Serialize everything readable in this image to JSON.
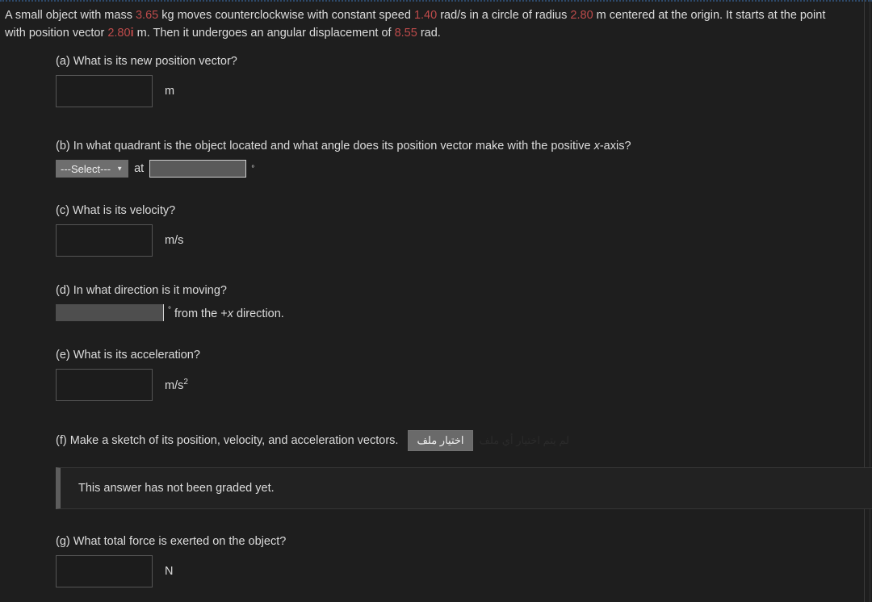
{
  "problem": {
    "text_1": "A small object with mass ",
    "mass": "3.65",
    "text_2": " kg moves counterclockwise with constant speed ",
    "speed": "1.40",
    "text_3": " rad/s in a circle of radius ",
    "radius": "2.80",
    "text_4": " m centered at the origin. It starts at the point with position vector ",
    "position": "2.80",
    "position_unit_vector": "i",
    "text_5": " m. Then it undergoes an angular displacement of ",
    "displacement": "8.55",
    "text_6": " rad."
  },
  "parts": {
    "a": {
      "question": "(a) What is its new position vector?",
      "value": "",
      "unit": "m"
    },
    "b": {
      "question_pre": "(b) In what quadrant is the object located and what angle does its position vector make with the positive ",
      "question_italic": "x",
      "question_post": "-axis?",
      "select_value": "---Select---",
      "caret": "▼",
      "at_label": "at",
      "value": "",
      "unit": "°"
    },
    "c": {
      "question": "(c) What is its velocity?",
      "value": "",
      "unit": "m/s"
    },
    "d": {
      "question": "(d) In what direction is it moving?",
      "value": "",
      "degree": "°",
      "suffix_pre": " from the +",
      "suffix_italic": "x",
      "suffix_post": " direction."
    },
    "e": {
      "question": "(e) What is its acceleration?",
      "value": "",
      "unit_base": "m/s",
      "unit_sup": "2"
    },
    "f": {
      "question": "(f) Make a sketch of its position, velocity, and acceleration vectors.",
      "file_button_label": "اختيار ملف",
      "file_status": "لم يتم اختيار أي ملف",
      "notice": "This answer has not been graded yet."
    },
    "g": {
      "question": "(g) What total force is exerted on the object?",
      "value": "",
      "unit": "N"
    }
  },
  "colors": {
    "background": "#1e1e1e",
    "text": "#dcdcdc",
    "number_highlight": "#bf4b4b",
    "input_border": "#555555",
    "select_background": "#6e6e6e",
    "notice_accent": "#5d5d5d",
    "top_border": "#2e4a6b"
  }
}
